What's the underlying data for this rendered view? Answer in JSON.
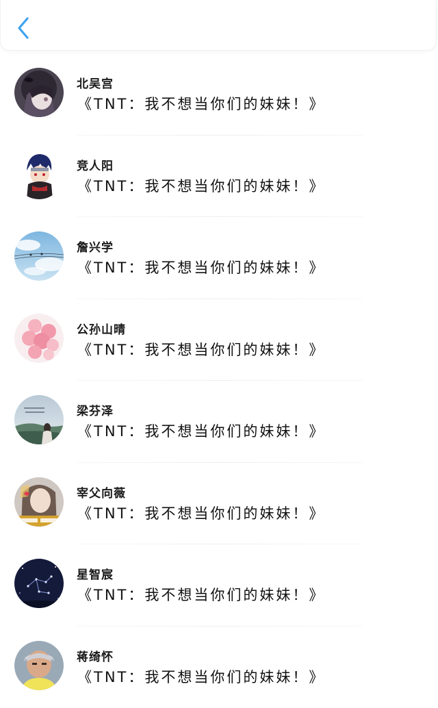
{
  "header": {
    "back_icon": "chevron-left-icon",
    "accent_color": "#3ea3f0"
  },
  "contacts": [
    {
      "name": "北吴宫",
      "message": "《TNT：我不想当你们的妹妹！》",
      "avatar": "anime-girl-avatar"
    },
    {
      "name": "竞人阳",
      "message": "《TNT：我不想当你们的妹妹！》",
      "avatar": "ninja-character-avatar"
    },
    {
      "name": "詹兴学",
      "message": "《TNT：我不想当你们的妹妹！》",
      "avatar": "sky-clouds-avatar"
    },
    {
      "name": "公孙山晴",
      "message": "《TNT：我不想当你们的妹妹！》",
      "avatar": "pink-balloons-avatar"
    },
    {
      "name": "梁芬泽",
      "message": "《TNT：我不想当你们的妹妹！》",
      "avatar": "coastal-landscape-avatar"
    },
    {
      "name": "宰父向薇",
      "message": "《TNT：我不想当你们的妹妹！》",
      "avatar": "selfie-girl-avatar"
    },
    {
      "name": "星智宸",
      "message": "《TNT：我不想当你们的妹妹！》",
      "avatar": "night-constellation-avatar"
    },
    {
      "name": "蒋绮怀",
      "message": "《TNT：我不想当你们的妹妹！》",
      "avatar": "person-photo-avatar"
    }
  ]
}
